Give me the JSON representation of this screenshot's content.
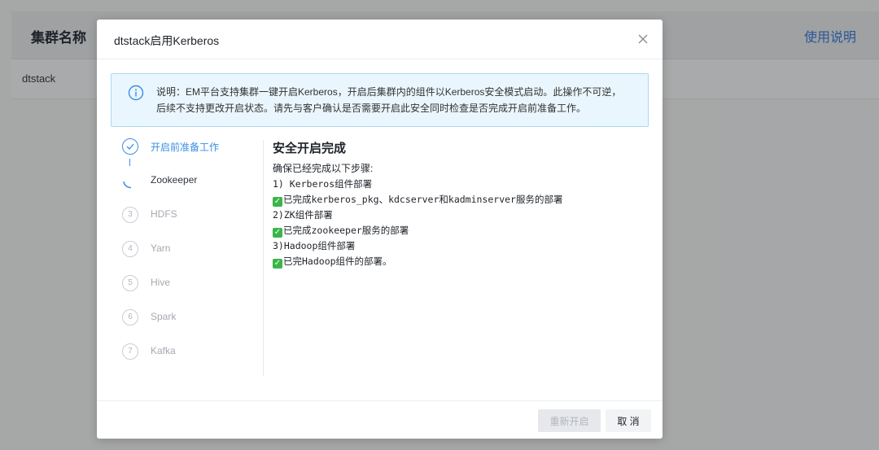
{
  "background": {
    "table_header_title": "集群名称",
    "help_link": "使用说明",
    "row_cell": "dtstack"
  },
  "modal": {
    "title": "dtstack启用Kerberos",
    "close_icon": "close-icon",
    "alert": {
      "icon": "info-icon",
      "line1": "说明：EM平台支持集群一键开启Kerberos，开启后集群内的组件以Kerberos安全模式启动。此操作不可逆，",
      "line2": "后续不支持更改开启状态。请先与客户确认是否需要开启此安全同时检查是否完成开启前准备工作。"
    },
    "steps": [
      {
        "number": "",
        "label": "开启前准备工作",
        "status": "done"
      },
      {
        "number": "",
        "label": "Zookeeper",
        "status": "running"
      },
      {
        "number": "3",
        "label": "HDFS",
        "status": "pending"
      },
      {
        "number": "4",
        "label": "Yarn",
        "status": "pending"
      },
      {
        "number": "5",
        "label": "Hive",
        "status": "pending"
      },
      {
        "number": "6",
        "label": "Spark",
        "status": "pending"
      },
      {
        "number": "7",
        "label": "Kafka",
        "status": "pending"
      }
    ],
    "content": {
      "title": "安全开启完成",
      "intro": "确保已经完成以下步骤:",
      "lines": [
        "1) Kerberos组件部署",
        "已完成kerberos_pkg、kdcserver和kadminserver服务的部署",
        "2)ZK组件部署",
        "已完成zookeeper服务的部署",
        "3)Hadoop组件部署",
        "已完Hadoop组件的部署。"
      ]
    },
    "footer": {
      "restart_label": "重新开启",
      "cancel_label": "取 消"
    },
    "colors": {
      "primary": "#3a8ee6",
      "alert_bg": "#eaf6fd",
      "check": "#3bb54a"
    }
  }
}
